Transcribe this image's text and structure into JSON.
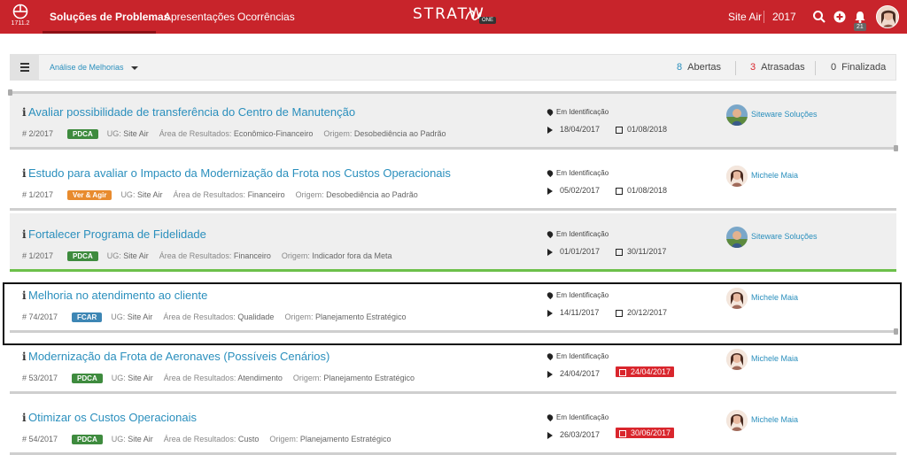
{
  "topbar": {
    "version": "1711.2",
    "nav": [
      "Soluções de Problemas",
      "Apresentações",
      "Ocorrências"
    ],
    "brand": "STRATW",
    "brand_suffix": "ONE",
    "unit": "Site Air",
    "year": "2017",
    "notifications": "21",
    "colors": {
      "bar": "#c8242b"
    }
  },
  "toolbar": {
    "view": "Análise de Melhorias",
    "stats": [
      {
        "num": "8",
        "label": "Abertas",
        "color": "#2a8fbd"
      },
      {
        "num": "3",
        "label": "Atrasadas",
        "color": "#d9262d"
      },
      {
        "num": "0",
        "label": "Finalizada",
        "color": "#444"
      }
    ]
  },
  "labels": {
    "ug": "UG:",
    "area": "Área de Resultados:",
    "origem": "Origem:"
  },
  "items": [
    {
      "title": "Avaliar possibilidade de transferência do Centro de Manutenção",
      "code": "# 2/2017",
      "tag": "PDCA",
      "ug": "Site Air",
      "area": "Econômico-Financeiro",
      "origem": "Desobediência ao Padrão",
      "status": "Em Identificação",
      "start": "18/04/2017",
      "end": "01/08/2018",
      "late": false,
      "resp": "Siteware Soluções"
    },
    {
      "title": "Estudo para avaliar o Impacto da Modernização da Frota nos Custos Operacionais",
      "code": "# 1/2017",
      "tag": "Ver & Agir",
      "ug": "Site Air",
      "area": "Financeiro",
      "origem": "Desobediência ao Padrão",
      "status": "Em Identificação",
      "start": "05/02/2017",
      "end": "01/08/2018",
      "late": false,
      "resp": "Michele Maia"
    },
    {
      "title": "Fortalecer Programa de Fidelidade",
      "code": "# 1/2017",
      "tag": "PDCA",
      "ug": "Site Air",
      "area": "Financeiro",
      "origem": "Indicador fora da Meta",
      "status": "Em Identificação",
      "start": "01/01/2017",
      "end": "30/11/2017",
      "late": false,
      "resp": "Siteware Soluções"
    },
    {
      "title": "Melhoria no atendimento ao cliente",
      "code": "# 74/2017",
      "tag": "FCAR",
      "ug": "Site Air",
      "area": "Qualidade",
      "origem": "Planejamento Estratégico",
      "status": "Em Identificação",
      "start": "14/11/2017",
      "end": "20/12/2017",
      "late": false,
      "resp": "Michele Maia"
    },
    {
      "title": "Modernização da Frota de Aeronaves (Possíveis Cenários)",
      "code": "# 53/2017",
      "tag": "PDCA",
      "ug": "Site Air",
      "area": "Atendimento",
      "origem": "Planejamento Estratégico",
      "status": "Em Identificação",
      "start": "24/04/2017",
      "end": "24/04/2017",
      "late": true,
      "resp": "Michele Maia"
    },
    {
      "title": "Otimizar os Custos Operacionais",
      "code": "# 54/2017",
      "tag": "PDCA",
      "ug": "Site Air",
      "area": "Custo",
      "origem": "Planejamento Estratégico",
      "status": "Em Identificação",
      "start": "26/03/2017",
      "end": "30/06/2017",
      "late": true,
      "resp": "Michele Maia"
    }
  ]
}
